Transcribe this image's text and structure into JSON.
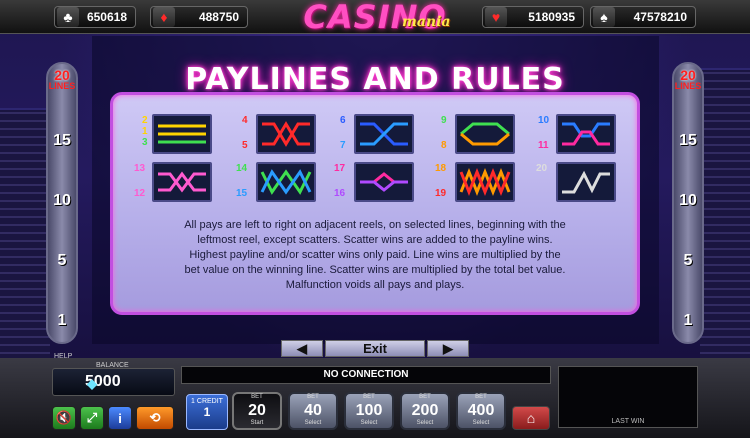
{
  "colors": {
    "title_glow": "#ff40d0",
    "card_border": "#c24fe0",
    "lines_red": "#ff2020"
  },
  "jackpots": [
    {
      "suit": "♣",
      "suit_color": "#ffffff",
      "value": "650618"
    },
    {
      "suit": "♦",
      "suit_color": "#ff2a2a",
      "value": "488750"
    },
    {
      "suit": "♥",
      "suit_color": "#ff2a2a",
      "value": "5180935"
    },
    {
      "suit": "♠",
      "suit_color": "#ffffff",
      "value": "47578210"
    }
  ],
  "logo": {
    "main": "CASINO",
    "sub": "mania"
  },
  "side_panel": {
    "lines_count": "20",
    "lines_label": "LINES",
    "numbers": [
      "15",
      "10",
      "5",
      "1"
    ]
  },
  "screen": {
    "title": "PAYLINES AND RULES",
    "rules_text": [
      "All pays are left to right on adjacent reels, on selected lines, beginning with the",
      "leftmost reel, except scatters. Scatter wins are added to the payline wins.",
      "Highest payline and/or scatter  wins only paid. Line wins are multiplied by the",
      "bet value on the winning line. Scatter wins are multiplied by the total bet value.",
      "Malfunction voids all pays and plays."
    ]
  },
  "paylines": [
    {
      "labels": [
        {
          "t": "2",
          "c": "#ffd400"
        },
        {
          "t": "1",
          "c": "#ffd400"
        },
        {
          "t": "3",
          "c": "#3fe050"
        }
      ],
      "icon": "straight-lines"
    },
    {
      "labels": [
        {
          "t": "4",
          "c": "#ff2a2a"
        },
        {
          "t": "5",
          "c": "#ff2a2a"
        }
      ],
      "icon": "v-cross"
    },
    {
      "labels": [
        {
          "t": "6",
          "c": "#2a5cff"
        },
        {
          "t": "7",
          "c": "#2a9cff"
        }
      ],
      "icon": "step-cross"
    },
    {
      "labels": [
        {
          "t": "9",
          "c": "#3fe050"
        },
        {
          "t": "8",
          "c": "#ff9a00"
        }
      ],
      "icon": "hexagon"
    },
    {
      "labels": [
        {
          "t": "10",
          "c": "#2a7cff"
        },
        {
          "t": "11",
          "c": "#ff2aa0"
        }
      ],
      "icon": "dip-cross"
    },
    {
      "labels": [
        {
          "t": "13",
          "c": "#ff5ad0"
        },
        {
          "t": "12",
          "c": "#ff5ad0"
        }
      ],
      "icon": "wave-pink"
    },
    {
      "labels": [
        {
          "t": "14",
          "c": "#3fe050"
        },
        {
          "t": "15",
          "c": "#2a9cff"
        }
      ],
      "icon": "wave-green"
    },
    {
      "labels": [
        {
          "t": "17",
          "c": "#ff2aa0"
        },
        {
          "t": "16",
          "c": "#b04aff"
        }
      ],
      "icon": "diamond"
    },
    {
      "labels": [
        {
          "t": "18",
          "c": "#ff9a00"
        },
        {
          "t": "19",
          "c": "#ff2a2a"
        }
      ],
      "icon": "zigzag"
    },
    {
      "labels": [
        {
          "t": "20",
          "c": "#dddddd"
        }
      ],
      "icon": "w-line"
    }
  ],
  "nav": {
    "prev_arrow": "◀",
    "exit": "Exit",
    "next_arrow": "▶"
  },
  "bottom": {
    "help_label": "HELP",
    "balance_label": "BALANCE",
    "balance_value": "5000",
    "status": "NO CONNECTION",
    "last_win_label": "LAST WIN",
    "credit_label": "1 CREDIT",
    "credit_value": "1",
    "bets": [
      {
        "cap": "BET",
        "value": "20",
        "sub": "Start",
        "selected": true
      },
      {
        "cap": "BET",
        "value": "40",
        "sub": "Select",
        "selected": false
      },
      {
        "cap": "BET",
        "value": "100",
        "sub": "Select",
        "selected": false
      },
      {
        "cap": "BET",
        "value": "200",
        "sub": "Select",
        "selected": false
      },
      {
        "cap": "BET",
        "value": "400",
        "sub": "Select",
        "selected": false
      }
    ]
  }
}
